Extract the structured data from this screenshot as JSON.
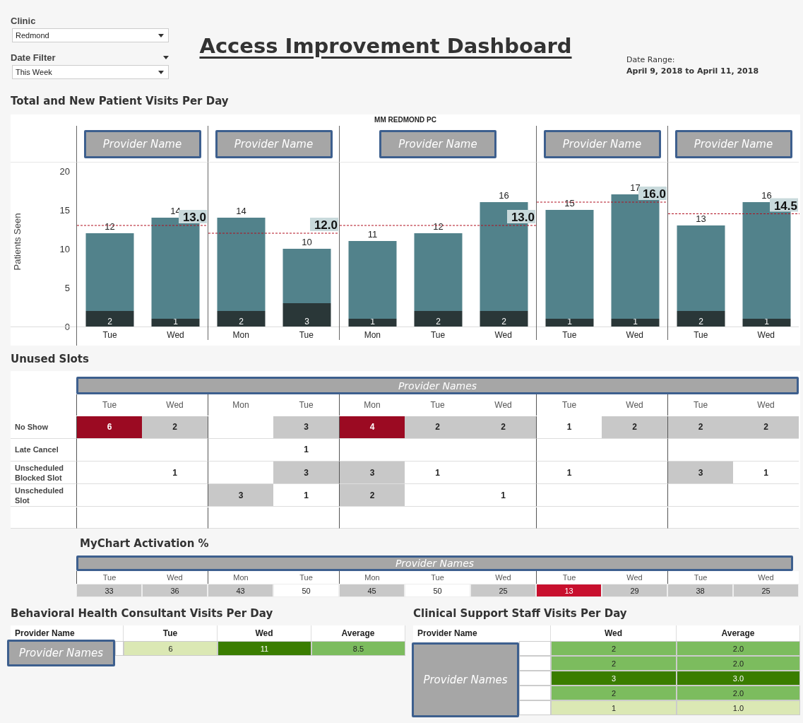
{
  "clinic_filter": {
    "label": "Clinic",
    "value": "Redmond"
  },
  "date_filter": {
    "label": "Date Filter",
    "value": "This Week"
  },
  "title": "Access Improvement Dashboard",
  "date_range": {
    "label": "Date Range:",
    "value": "April 9, 2018 to April 11, 2018"
  },
  "visits_chart": {
    "title": "Total and New Patient Visits Per Day",
    "facet": "MM REDMOND PC",
    "panes": [
      {
        "provider": "Provider Name",
        "chart_data": {
          "type": "bar",
          "stacked": true,
          "ylabel": "Patients Seen",
          "categories": [
            "Tue",
            "Wed"
          ],
          "series": [
            {
              "color": "#2a3738",
              "values": [
                2,
                1
              ],
              "value_labels": [
                "2",
                "1"
              ]
            },
            {
              "color": "#52828b",
              "values": [
                10,
                13
              ]
            }
          ],
          "ylim": [
            0,
            20
          ],
          "yticks": [
            0,
            5,
            10,
            15,
            20
          ],
          "ref_lines": [
            {
              "axis": "y",
              "value": 13.0,
              "label": "13.0"
            }
          ],
          "annotations": [
            {
              "x": "Tue",
              "y": 12,
              "text": "12"
            },
            {
              "x": "Wed",
              "y": 14,
              "text": "14"
            }
          ]
        }
      },
      {
        "provider": "Provider Name",
        "chart_data": {
          "type": "bar",
          "stacked": true,
          "categories": [
            "Mon",
            "Tue"
          ],
          "series": [
            {
              "color": "#2a3738",
              "values": [
                2,
                3
              ],
              "value_labels": [
                "2",
                "3"
              ]
            },
            {
              "color": "#52828b",
              "values": [
                12,
                7
              ]
            }
          ],
          "ylim": [
            0,
            20
          ],
          "ref_lines": [
            {
              "axis": "y",
              "value": 12.0,
              "label": "12.0"
            }
          ],
          "annotations": [
            {
              "x": "Mon",
              "y": 14,
              "text": "14"
            },
            {
              "x": "Tue",
              "y": 10,
              "text": "10"
            }
          ]
        }
      },
      {
        "provider": "Provider Name",
        "chart_data": {
          "type": "bar",
          "stacked": true,
          "categories": [
            "Mon",
            "Tue",
            "Wed"
          ],
          "series": [
            {
              "color": "#2a3738",
              "values": [
                1,
                2,
                2
              ],
              "value_labels": [
                "1",
                "2",
                "2"
              ]
            },
            {
              "color": "#52828b",
              "values": [
                10,
                10,
                14
              ]
            }
          ],
          "ylim": [
            0,
            20
          ],
          "ref_lines": [
            {
              "axis": "y",
              "value": 13.0,
              "label": "13.0"
            }
          ],
          "annotations": [
            {
              "x": "Mon",
              "y": 11,
              "text": "11"
            },
            {
              "x": "Tue",
              "y": 12,
              "text": "12"
            },
            {
              "x": "Wed",
              "y": 16,
              "text": "16"
            }
          ]
        }
      },
      {
        "provider": "Provider Name",
        "chart_data": {
          "type": "bar",
          "stacked": true,
          "categories": [
            "Tue",
            "Wed"
          ],
          "series": [
            {
              "color": "#2a3738",
              "values": [
                1,
                1
              ],
              "value_labels": [
                "1",
                "1"
              ]
            },
            {
              "color": "#52828b",
              "values": [
                14,
                16
              ]
            }
          ],
          "ylim": [
            0,
            20
          ],
          "ref_lines": [
            {
              "axis": "y",
              "value": 16.0,
              "label": "16.0"
            }
          ],
          "annotations": [
            {
              "x": "Tue",
              "y": 15,
              "text": "15"
            },
            {
              "x": "Wed",
              "y": 17,
              "text": "17"
            }
          ]
        }
      },
      {
        "provider": "Provider Name",
        "chart_data": {
          "type": "bar",
          "stacked": true,
          "categories": [
            "Tue",
            "Wed"
          ],
          "series": [
            {
              "color": "#2a3738",
              "values": [
                2,
                1
              ],
              "value_labels": [
                "2",
                "1"
              ]
            },
            {
              "color": "#52828b",
              "values": [
                11,
                15
              ]
            }
          ],
          "ylim": [
            0,
            20
          ],
          "ref_lines": [
            {
              "axis": "y",
              "value": 14.5,
              "label": "14.5"
            }
          ],
          "annotations": [
            {
              "x": "Tue",
              "y": 13,
              "text": "13"
            },
            {
              "x": "Wed",
              "y": 16,
              "text": "16"
            }
          ]
        }
      }
    ]
  },
  "unused_slots": {
    "title": "Unused Slots",
    "providers": "Provider Names",
    "days": [
      "Tue",
      "Wed",
      "Mon",
      "Tue",
      "Mon",
      "Tue",
      "Wed",
      "Tue",
      "Wed",
      "Tue",
      "Wed"
    ],
    "rows": [
      {
        "label": "No Show",
        "cells": [
          {
            "value": "6",
            "color": "#9b0a22"
          },
          {
            "value": "2",
            "color": "#c8c8c8"
          },
          {
            "color": "#ffffff"
          },
          {
            "value": "3",
            "color": "#c8c8c8"
          },
          {
            "value": "4",
            "color": "#9b0a22"
          },
          {
            "value": "2",
            "color": "#c8c8c8"
          },
          {
            "value": "2",
            "color": "#c8c8c8"
          },
          {
            "value": "1",
            "color": "#ffffff"
          },
          {
            "value": "2",
            "color": "#c8c8c8"
          },
          {
            "value": "2",
            "color": "#c8c8c8"
          },
          {
            "value": "2",
            "color": "#c8c8c8"
          }
        ]
      },
      {
        "label": "Late Cancel",
        "cells": [
          {
            "color": "#ffffff"
          },
          {
            "color": "#ffffff"
          },
          {
            "color": "#ffffff"
          },
          {
            "value": "1",
            "color": "#ffffff"
          },
          {
            "color": "#ffffff"
          },
          {
            "color": "#ffffff"
          },
          {
            "color": "#ffffff"
          },
          {
            "color": "#ffffff"
          },
          {
            "color": "#ffffff"
          },
          {
            "color": "#ffffff"
          },
          {
            "color": "#ffffff"
          }
        ]
      },
      {
        "label": "Unscheduled Blocked Slot",
        "cells": [
          {
            "color": "#ffffff"
          },
          {
            "value": "1",
            "color": "#ffffff"
          },
          {
            "color": "#ffffff"
          },
          {
            "value": "3",
            "color": "#c8c8c8"
          },
          {
            "value": "3",
            "color": "#c8c8c8"
          },
          {
            "value": "1",
            "color": "#ffffff"
          },
          {
            "color": "#ffffff"
          },
          {
            "value": "1",
            "color": "#ffffff"
          },
          {
            "color": "#ffffff"
          },
          {
            "value": "3",
            "color": "#c8c8c8"
          },
          {
            "value": "1",
            "color": "#ffffff"
          }
        ]
      },
      {
        "label": "Unscheduled Slot",
        "cells": [
          {
            "color": "#ffffff"
          },
          {
            "color": "#ffffff"
          },
          {
            "value": "3",
            "color": "#c8c8c8"
          },
          {
            "value": "1",
            "color": "#ffffff"
          },
          {
            "value": "2",
            "color": "#c8c8c8"
          },
          {
            "color": "#ffffff"
          },
          {
            "value": "1",
            "color": "#ffffff"
          },
          {
            "color": "#ffffff"
          },
          {
            "color": "#ffffff"
          },
          {
            "color": "#ffffff"
          },
          {
            "color": "#ffffff"
          }
        ]
      }
    ]
  },
  "mychart": {
    "title": "MyChart Activation %",
    "providers": "Provider Names",
    "days": [
      "Tue",
      "Wed",
      "Mon",
      "Tue",
      "Mon",
      "Tue",
      "Wed",
      "Tue",
      "Wed",
      "Tue",
      "Wed"
    ],
    "cells": [
      {
        "value": "33",
        "color": "#c8c8c8"
      },
      {
        "value": "36",
        "color": "#c8c8c8"
      },
      {
        "value": "43",
        "color": "#c8c8c8"
      },
      {
        "value": "50",
        "color": "#ffffff"
      },
      {
        "value": "45",
        "color": "#c8c8c8"
      },
      {
        "value": "50",
        "color": "#ffffff"
      },
      {
        "value": "25",
        "color": "#c8c8c8"
      },
      {
        "value": "13",
        "color": "#c8102e"
      },
      {
        "value": "29",
        "color": "#c8c8c8"
      },
      {
        "value": "38",
        "color": "#c8c8c8"
      },
      {
        "value": "25",
        "color": "#c8c8c8"
      }
    ]
  },
  "bhc": {
    "title": "Behavioral Health Consultant Visits Per Day",
    "columns": [
      "Provider Name",
      "Tue",
      "Wed",
      "Average"
    ],
    "providers": "Provider Names",
    "rows": [
      {
        "cells": [
          {
            "color": "#ffffff"
          },
          {
            "value": "6",
            "color": "#dbe8b4"
          },
          {
            "value": "11",
            "color": "#3a7d00"
          },
          {
            "value": "8.5",
            "color": "#7cbc5e"
          }
        ]
      }
    ]
  },
  "css": {
    "title": "Clinical Support Staff Visits Per Day",
    "columns": [
      "Provider Name",
      "Wed",
      "Average"
    ],
    "providers": "Provider Names",
    "rows": [
      {
        "cells": [
          {
            "color": "#ffffff"
          },
          {
            "value": "2",
            "color": "#7cbc5e"
          },
          {
            "value": "2.0",
            "color": "#7cbc5e"
          }
        ]
      },
      {
        "cells": [
          {
            "color": "#ffffff"
          },
          {
            "value": "2",
            "color": "#7cbc5e"
          },
          {
            "value": "2.0",
            "color": "#7cbc5e"
          }
        ]
      },
      {
        "cells": [
          {
            "color": "#ffffff"
          },
          {
            "value": "3",
            "color": "#3a7d00"
          },
          {
            "value": "3.0",
            "color": "#3a7d00"
          }
        ]
      },
      {
        "cells": [
          {
            "color": "#ffffff"
          },
          {
            "value": "2",
            "color": "#7cbc5e"
          },
          {
            "value": "2.0",
            "color": "#7cbc5e"
          }
        ]
      },
      {
        "cells": [
          {
            "color": "#ffffff"
          },
          {
            "value": "1",
            "color": "#dbe8b4"
          },
          {
            "value": "1.0",
            "color": "#dbe8b4"
          }
        ]
      }
    ]
  }
}
